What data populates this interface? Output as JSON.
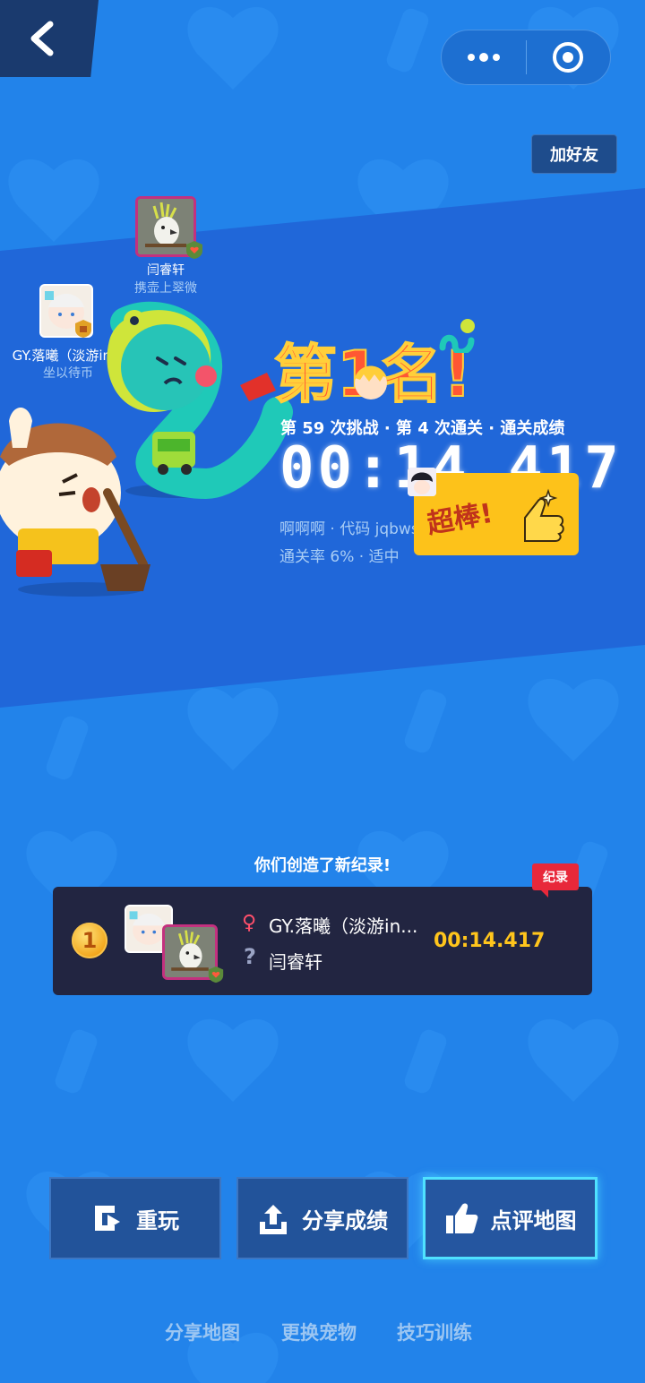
{
  "colors": {
    "background": "#2283ea",
    "band": "#2067d9",
    "card": "#222541",
    "accent_gold": "#ffc51c",
    "record_red": "#e8283a",
    "highlight_border": "#4fe1ff"
  },
  "header": {
    "back_icon": "chevron-left-icon",
    "menu_icon": "more-dots-icon",
    "close_icon": "target-circle-icon",
    "add_friend_label": "加好友"
  },
  "players": {
    "player2": {
      "name": "闫睿轩",
      "subtitle": "携壶上翠微"
    },
    "player1": {
      "name": "GY.落曦（淡游in...",
      "subtitle": "坐以待币"
    }
  },
  "result": {
    "rank_title": "第1名!",
    "stats_line": "第 59 次挑战 · 第 4 次通关 · 通关成绩",
    "time": "00:14.417",
    "map_line": "啊啊啊 · 代码 jqbws",
    "pass_rate_line": "通关率 6% · 适中",
    "badge_text": "超棒!"
  },
  "record": {
    "headline": "你们创造了新纪录!",
    "tag": "纪录",
    "rank": "1",
    "player1_name": "GY.落曦（淡游in...",
    "player2_name": "闫睿轩",
    "gender_symbol": "♀",
    "unknown_symbol": "?",
    "time": "00:14.417"
  },
  "actions": {
    "replay": "重玩",
    "share_result": "分享成绩",
    "rate_map": "点评地图"
  },
  "links": {
    "share_map": "分享地图",
    "change_pet": "更换宠物",
    "skill_training": "技巧训练"
  }
}
